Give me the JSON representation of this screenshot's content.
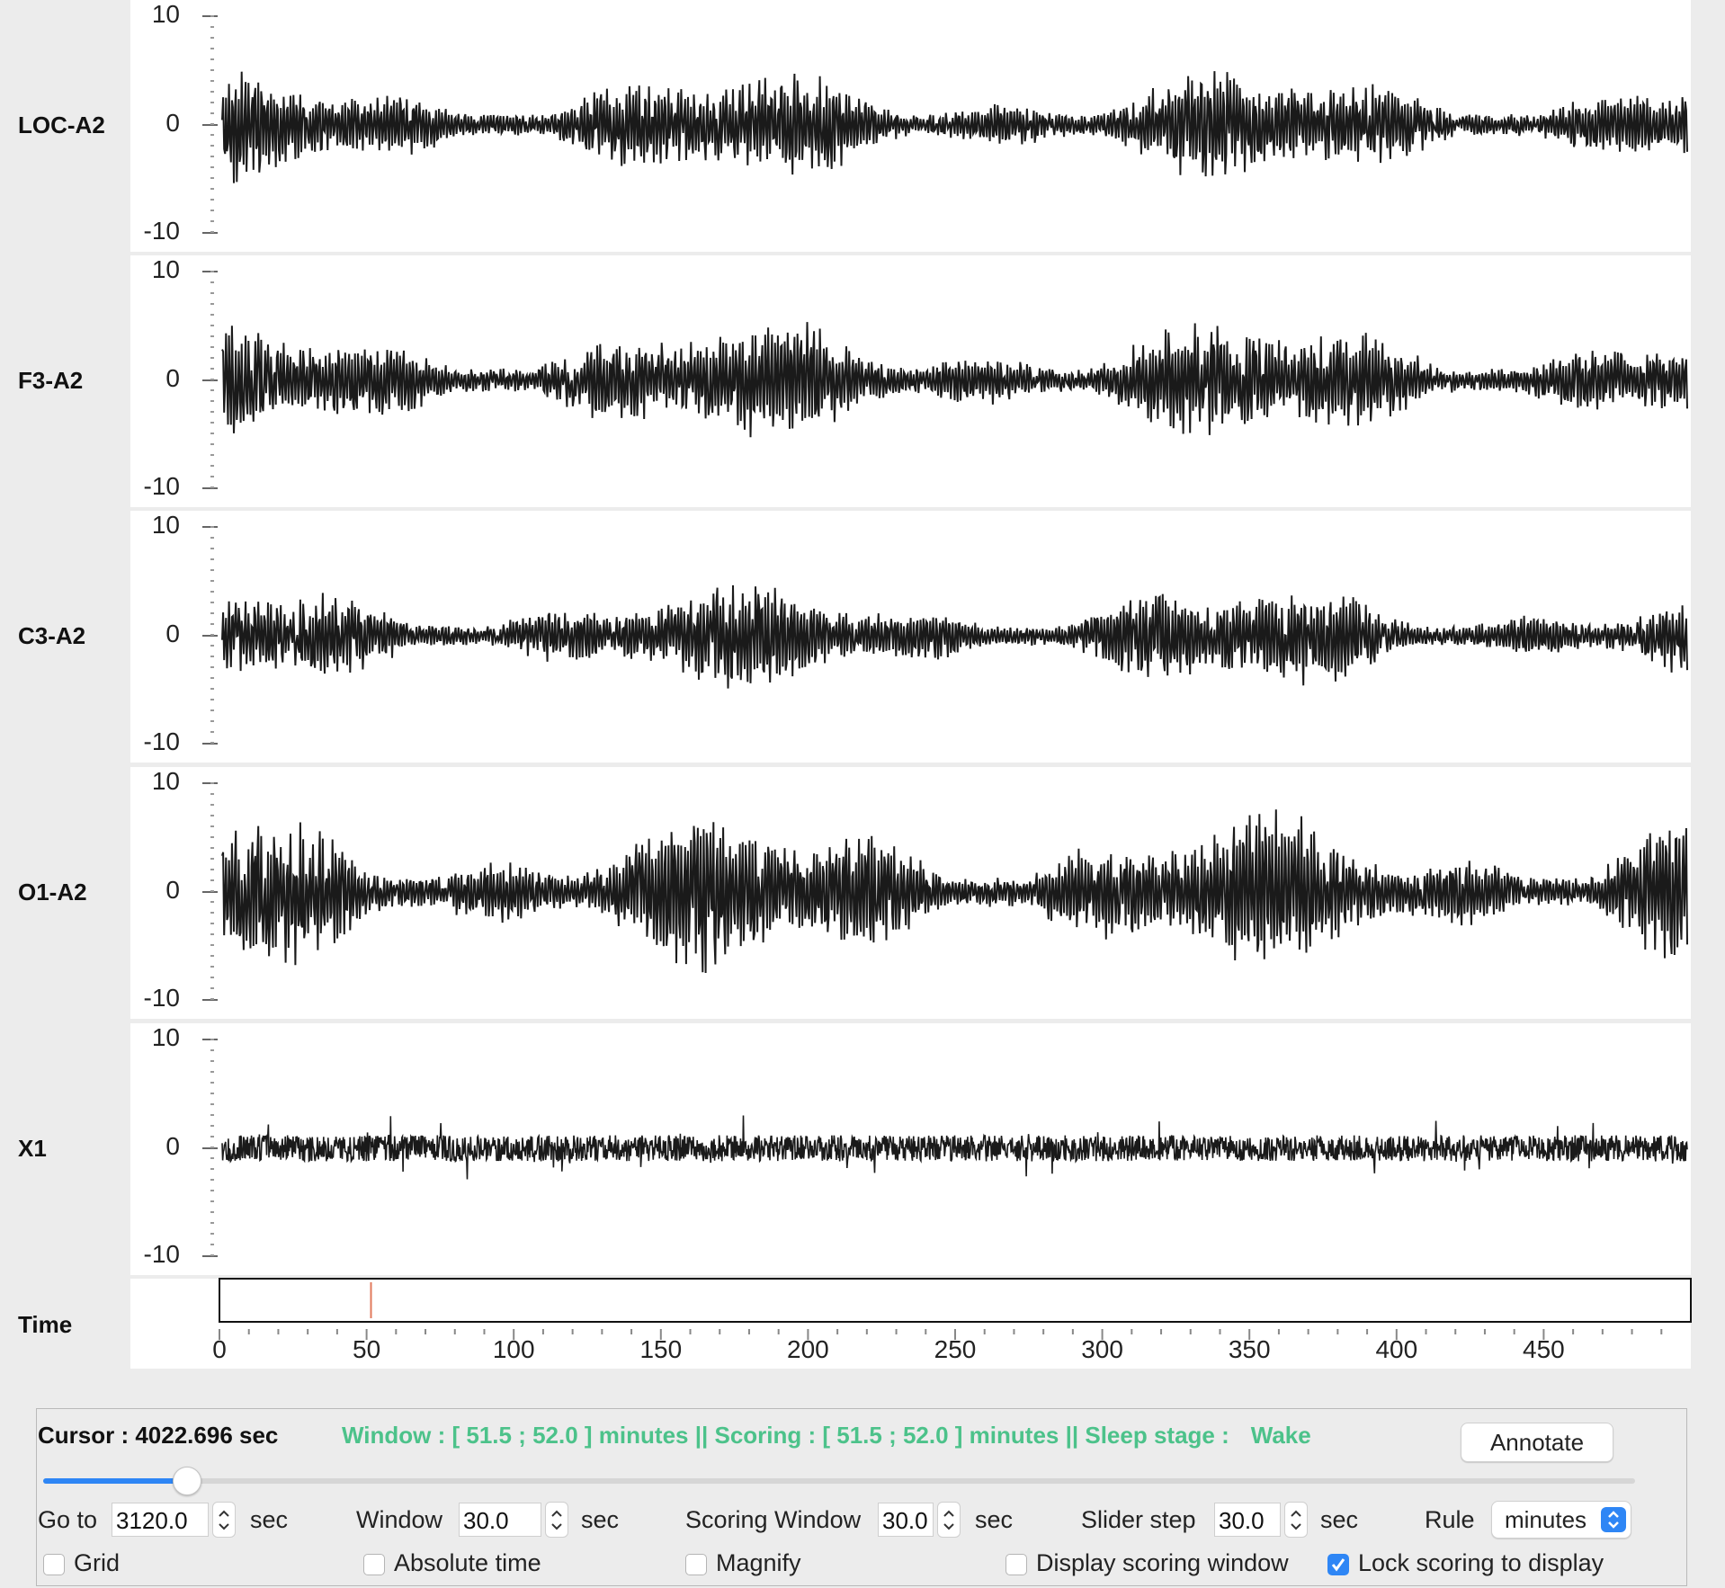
{
  "channels": [
    {
      "label": "LOC-A2",
      "ticks": [
        "10",
        "0",
        "-10"
      ],
      "seed": 11,
      "kind": "eog",
      "amp": 0.38
    },
    {
      "label": "F3-A2",
      "ticks": [
        "10",
        "0",
        "-10"
      ],
      "seed": 23,
      "kind": "eeg",
      "amp": 0.42
    },
    {
      "label": "C3-A2",
      "ticks": [
        "10",
        "0",
        "-10"
      ],
      "seed": 37,
      "kind": "eeg",
      "amp": 0.36
    },
    {
      "label": "O1-A2",
      "ticks": [
        "10",
        "0",
        "-10"
      ],
      "seed": 51,
      "kind": "eeg",
      "amp": 0.55
    },
    {
      "label": "X1",
      "ticks": [
        "10",
        "0",
        "-10"
      ],
      "seed": 67,
      "kind": "emg",
      "amp": 0.22
    }
  ],
  "time_axis": {
    "label": "Time",
    "tick_labels": [
      "0",
      "50",
      "100",
      "150",
      "200",
      "250",
      "300",
      "350",
      "400",
      "450"
    ],
    "range": [
      0,
      500
    ],
    "marker_value": 51.5,
    "marker_color": "#e27a5c"
  },
  "controls": {
    "cursor_text": "Cursor : 4022.696 sec",
    "status_text": "Window : [ 51.5 ; 52.0 ] minutes || Scoring : [ 51.5 ; 52.0 ] minutes || Sleep stage :",
    "sleep_stage": "Wake",
    "annotate_label": "Annotate",
    "slider_fraction": 0.09,
    "goto_label": "Go to",
    "goto_value": "3120.0",
    "goto_unit": "sec",
    "window_label": "Window",
    "window_value": "30.0",
    "window_unit": "sec",
    "scoring_window_label": "Scoring Window",
    "scoring_window_value": "30.0",
    "scoring_window_unit": "sec",
    "slider_step_label": "Slider step",
    "slider_step_value": "30.0",
    "slider_step_unit": "sec",
    "rule_label": "Rule",
    "rule_value": "minutes",
    "grid_label": "Grid",
    "grid_checked": false,
    "absolute_time_label": "Absolute time",
    "absolute_time_checked": false,
    "magnify_label": "Magnify",
    "magnify_checked": false,
    "display_scoring_label": "Display scoring window",
    "display_scoring_checked": false,
    "lock_scoring_label": "Lock scoring to display",
    "lock_scoring_checked": true
  },
  "colors": {
    "accent": "#2e86f5",
    "status_green": "#4cc28a",
    "trace": "#1a1a1a"
  }
}
